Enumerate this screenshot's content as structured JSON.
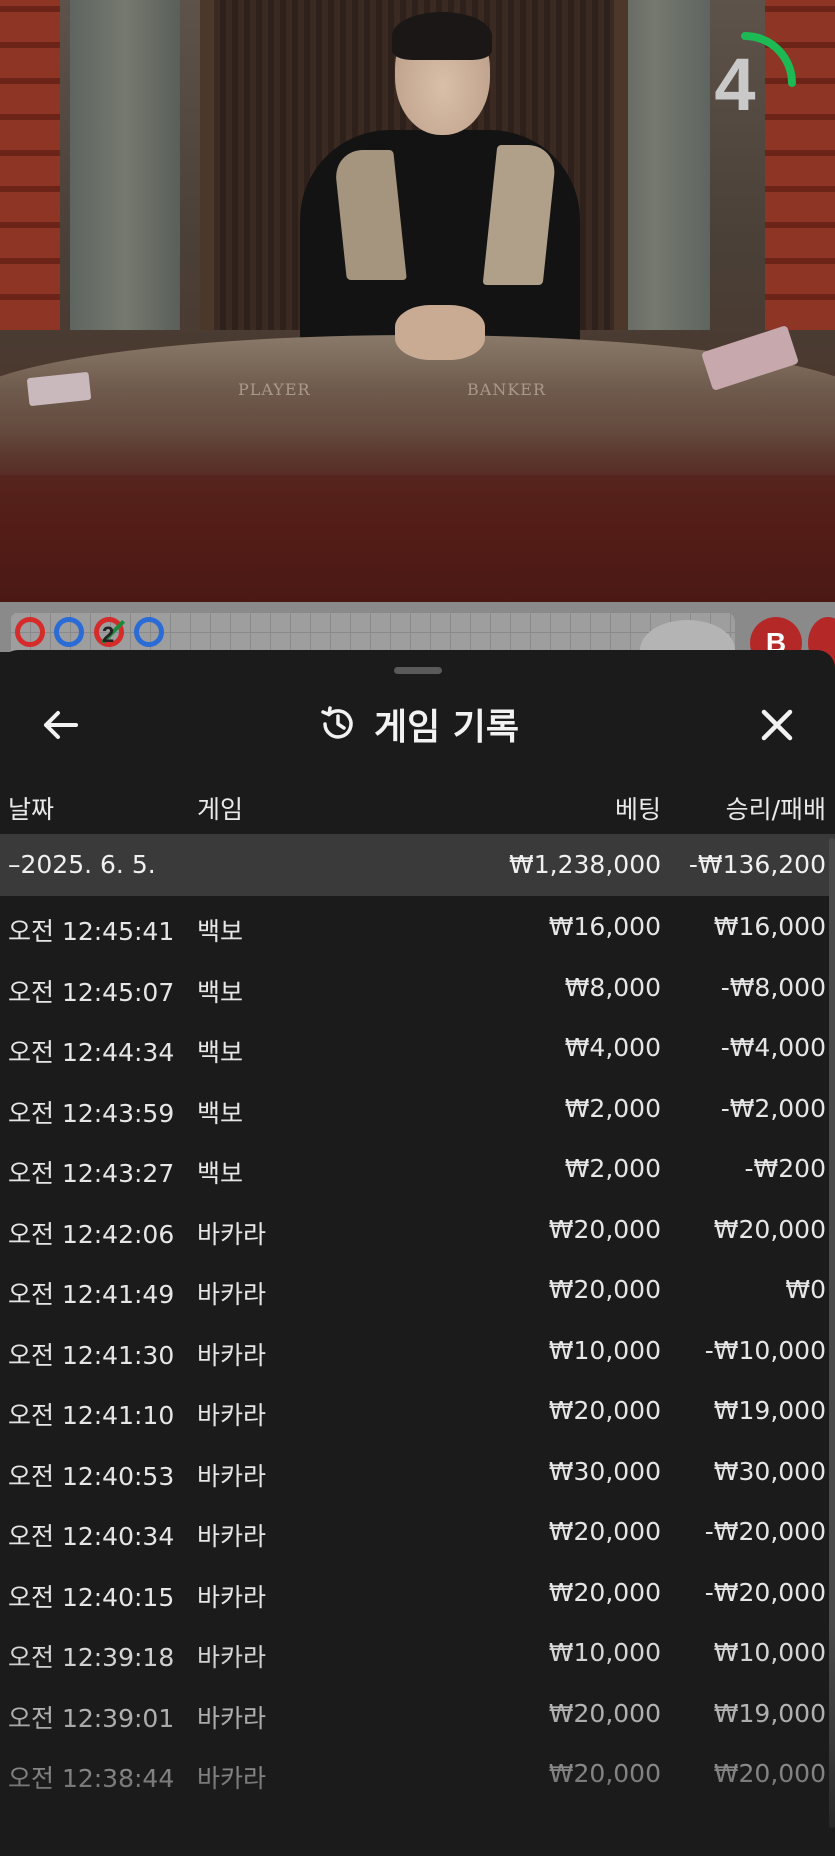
{
  "video": {
    "countdown": "4",
    "table_labels": {
      "player": "PLAYER",
      "banker": "BANKER"
    },
    "colors": {
      "timer_arc": "#1db954"
    }
  },
  "scoreboard": {
    "beads": [
      {
        "color": "#d62b2b"
      },
      {
        "color": "#2a6bd6"
      },
      {
        "color": "#d62b2b",
        "number": "2"
      },
      {
        "color": "#2a6bd6"
      }
    ],
    "badge": "B"
  },
  "panel": {
    "title": "게임 기록",
    "icons": {
      "back": "arrow-left-icon",
      "history": "history-icon",
      "close": "close-icon"
    }
  },
  "table": {
    "headers": {
      "date": "날짜",
      "game": "게임",
      "bet": "베팅",
      "winloss": "승리/패배"
    },
    "summary": {
      "date": "–2025. 6. 5.",
      "bet": "₩1,238,000",
      "winloss": "-₩136,200"
    },
    "rows": [
      {
        "time": "오전 12:45:41",
        "game": "백보",
        "bet": "₩16,000",
        "winloss": "₩16,000"
      },
      {
        "time": "오전 12:45:07",
        "game": "백보",
        "bet": "₩8,000",
        "winloss": "-₩8,000"
      },
      {
        "time": "오전 12:44:34",
        "game": "백보",
        "bet": "₩4,000",
        "winloss": "-₩4,000"
      },
      {
        "time": "오전 12:43:59",
        "game": "백보",
        "bet": "₩2,000",
        "winloss": "-₩2,000"
      },
      {
        "time": "오전 12:43:27",
        "game": "백보",
        "bet": "₩2,000",
        "winloss": "-₩200"
      },
      {
        "time": "오전 12:42:06",
        "game": "바카라",
        "bet": "₩20,000",
        "winloss": "₩20,000"
      },
      {
        "time": "오전 12:41:49",
        "game": "바카라",
        "bet": "₩20,000",
        "winloss": "₩0"
      },
      {
        "time": "오전 12:41:30",
        "game": "바카라",
        "bet": "₩10,000",
        "winloss": "-₩10,000"
      },
      {
        "time": "오전 12:41:10",
        "game": "바카라",
        "bet": "₩20,000",
        "winloss": "₩19,000"
      },
      {
        "time": "오전 12:40:53",
        "game": "바카라",
        "bet": "₩30,000",
        "winloss": "₩30,000"
      },
      {
        "time": "오전 12:40:34",
        "game": "바카라",
        "bet": "₩20,000",
        "winloss": "-₩20,000"
      },
      {
        "time": "오전 12:40:15",
        "game": "바카라",
        "bet": "₩20,000",
        "winloss": "-₩20,000"
      },
      {
        "time": "오전 12:39:18",
        "game": "바카라",
        "bet": "₩10,000",
        "winloss": "₩10,000"
      },
      {
        "time": "오전 12:39:01",
        "game": "바카라",
        "bet": "₩20,000",
        "winloss": "₩19,000"
      },
      {
        "time": "오전 12:38:44",
        "game": "바카라",
        "bet": "₩20,000",
        "winloss": "₩20,000"
      }
    ]
  }
}
